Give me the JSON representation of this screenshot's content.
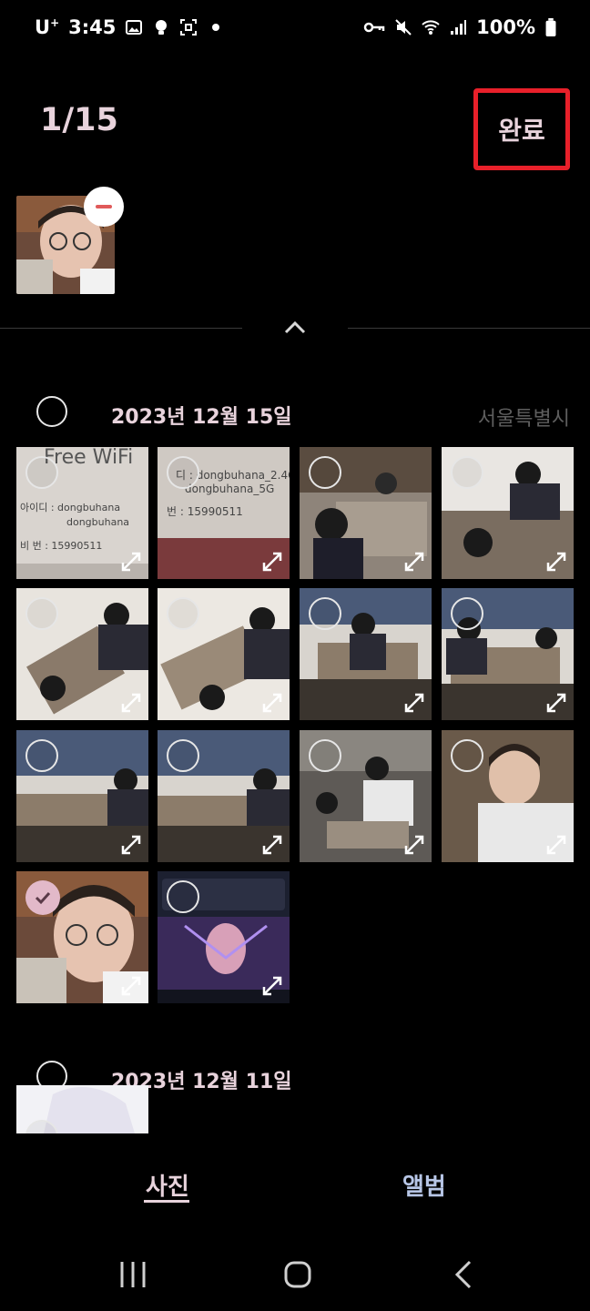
{
  "status_bar": {
    "carrier": "U",
    "carrier_sup": "+",
    "time": "3:45",
    "battery": "100%"
  },
  "header": {
    "counter": "1/15",
    "done_label": "완료",
    "done_highlight_color": "#e8202a"
  },
  "tray": {
    "selected_count": 1,
    "remove_icon": "minus-circle-icon"
  },
  "sections": [
    {
      "date": "2023년 12월 15일",
      "location": "서울특별시",
      "photos": [
        {
          "kind": "document",
          "selected": false
        },
        {
          "kind": "document",
          "selected": false
        },
        {
          "kind": "people-indoor",
          "selected": false
        },
        {
          "kind": "people-indoor",
          "selected": false
        },
        {
          "kind": "people-indoor",
          "selected": false
        },
        {
          "kind": "people-indoor",
          "selected": false
        },
        {
          "kind": "people-indoor",
          "selected": false
        },
        {
          "kind": "people-indoor",
          "selected": false
        },
        {
          "kind": "people-indoor",
          "selected": false
        },
        {
          "kind": "people-indoor",
          "selected": false
        },
        {
          "kind": "people-indoor",
          "selected": false
        },
        {
          "kind": "portrait",
          "selected": false
        },
        {
          "kind": "portrait",
          "selected": true
        },
        {
          "kind": "screenshot",
          "selected": false
        }
      ]
    },
    {
      "date": "2023년 12월 11일",
      "location": "",
      "photos": [
        {
          "kind": "illustration",
          "selected": false
        }
      ]
    }
  ],
  "tabs": {
    "photos": "사진",
    "albums": "앨범"
  },
  "colors": {
    "accent": "#e8d3dc",
    "album_tab": "#b7c6e6",
    "check": "#e2b9c9"
  }
}
